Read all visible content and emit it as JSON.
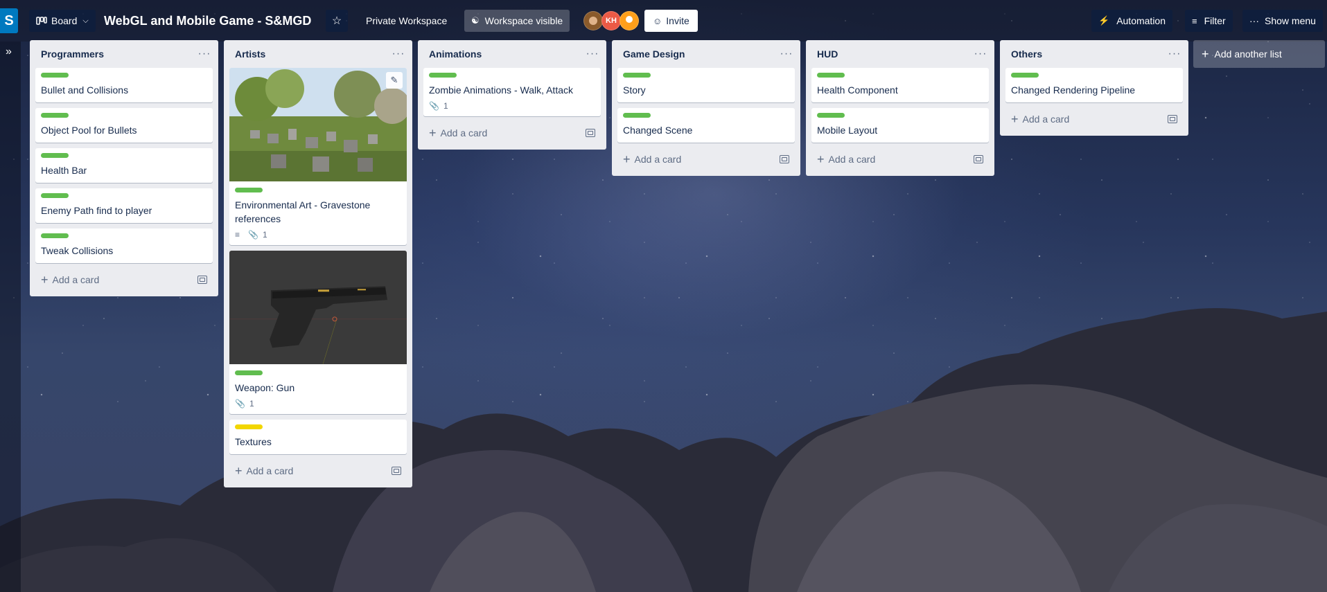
{
  "workspace": {
    "initial": "S"
  },
  "header": {
    "view_label": "Board",
    "board_title": "WebGL and Mobile Game - S&MGD",
    "workspace_name": "Private Workspace",
    "visibility_label": "Workspace visible",
    "avatar_initials": "KH",
    "invite_label": "Invite",
    "automation_label": "Automation",
    "filter_label": "Filter",
    "menu_label": "Show menu"
  },
  "lists": [
    {
      "title": "Programmers",
      "cards": [
        {
          "title": "Bullet and Collisions",
          "label": "green"
        },
        {
          "title": "Object Pool for Bullets",
          "label": "green"
        },
        {
          "title": "Health Bar",
          "label": "green"
        },
        {
          "title": "Enemy Path find to player",
          "label": "green"
        },
        {
          "title": "Tweak Collisions",
          "label": "green"
        }
      ],
      "add_label": "Add a card"
    },
    {
      "title": "Artists",
      "cards": [
        {
          "title": "Environmental Art - Gravestone references",
          "label": "green",
          "cover": "graveyard-photo",
          "has_description": true,
          "attachments": "1"
        },
        {
          "title": "Weapon: Gun",
          "label": "green",
          "cover": "gun-render",
          "attachments": "1"
        },
        {
          "title": "Textures",
          "label": "yellow"
        }
      ],
      "add_label": "Add a card"
    },
    {
      "title": "Animations",
      "cards": [
        {
          "title": "Zombie Animations - Walk, Attack",
          "label": "green",
          "attachments": "1"
        }
      ],
      "add_label": "Add a card"
    },
    {
      "title": "Game Design",
      "cards": [
        {
          "title": "Story",
          "label": "green"
        },
        {
          "title": "Changed Scene",
          "label": "green"
        }
      ],
      "add_label": "Add a card"
    },
    {
      "title": "HUD",
      "cards": [
        {
          "title": "Health Component",
          "label": "green"
        },
        {
          "title": "Mobile Layout",
          "label": "green"
        }
      ],
      "add_label": "Add a card"
    },
    {
      "title": "Others",
      "cards": [
        {
          "title": "Changed Rendering Pipeline",
          "label": "green"
        }
      ],
      "add_label": "Add a card"
    }
  ],
  "add_list_label": "Add another list",
  "colors": {
    "label_green": "#61bd4f",
    "label_yellow": "#f2d600",
    "list_bg": "#ebecf0",
    "invite_bg": "#ffffff"
  }
}
